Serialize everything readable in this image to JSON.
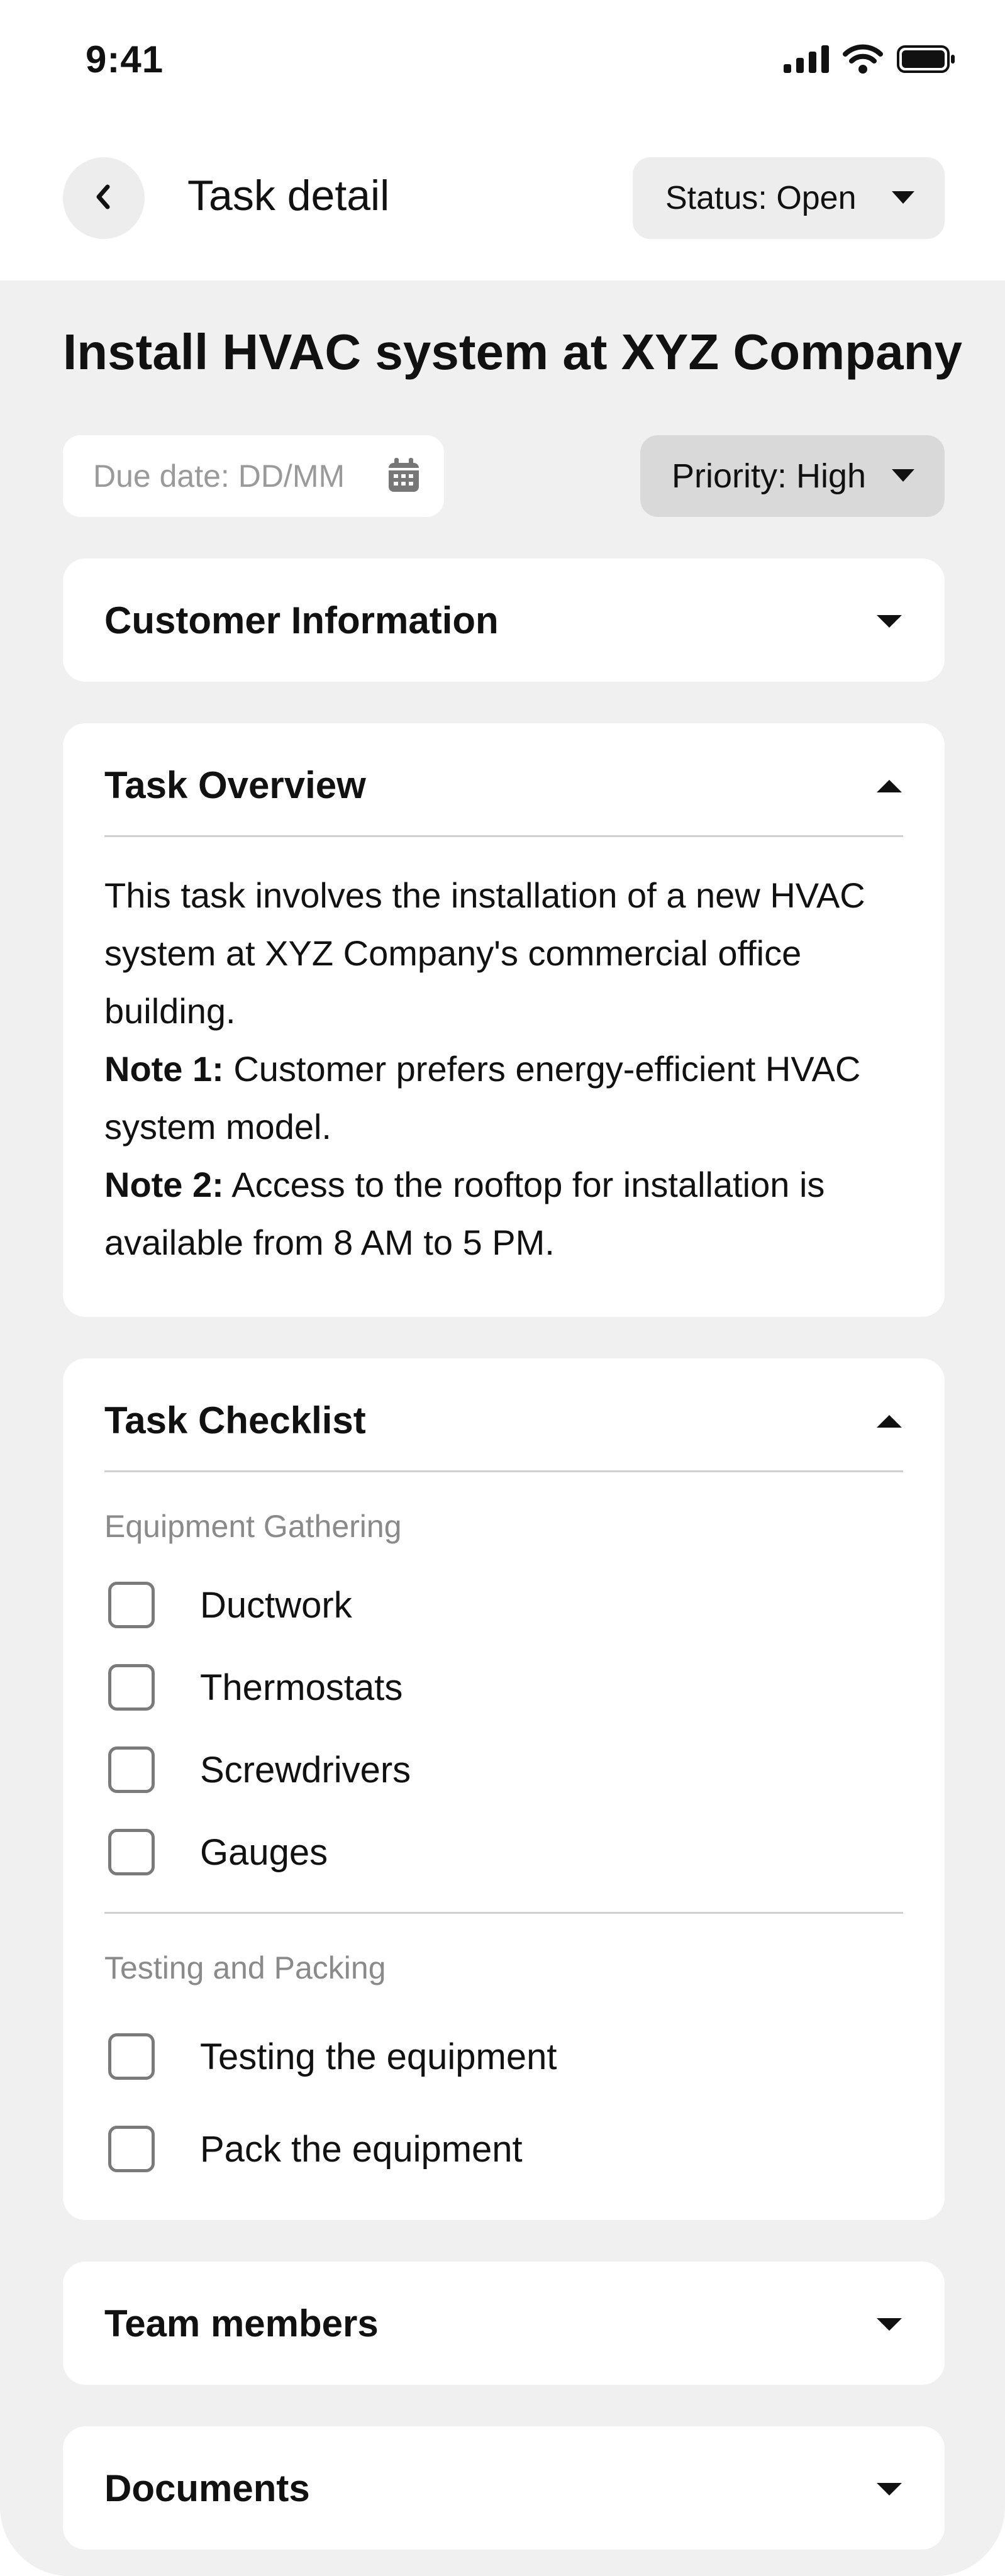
{
  "status_bar": {
    "time": "9:41"
  },
  "header": {
    "back_icon": "chevron-left-icon",
    "title": "Task detail",
    "status_select": "Status: Open"
  },
  "task": {
    "title": "Install HVAC system at XYZ Company",
    "due_date_placeholder": "Due date: DD/MM",
    "priority_select": "Priority: High"
  },
  "sections": {
    "customer_info": {
      "title": "Customer Information",
      "expanded": false
    },
    "overview": {
      "title": "Task Overview",
      "expanded": true,
      "text": "This task involves the installation of a new HVAC system at XYZ Company's commercial office building.",
      "note1_label": "Note 1:",
      "note1_text": " Customer prefers energy-efficient HVAC system model.",
      "note2_label": "Note 2:",
      "note2_text": " Access to the rooftop for installation is available from 8 AM to 5 PM."
    },
    "checklist": {
      "title": "Task Checklist",
      "expanded": true,
      "group1_label": "Equipment Gathering",
      "group1_items": [
        "Ductwork",
        "Thermostats",
        "Screwdrivers",
        "Gauges"
      ],
      "group2_label": "Testing and Packing",
      "group2_items": [
        "Testing the equipment",
        "Pack the equipment"
      ]
    },
    "team": {
      "title": "Team members",
      "expanded": false
    },
    "documents": {
      "title": "Documents",
      "expanded": false
    }
  },
  "colors": {
    "page_background": "#f0f0f0",
    "card_background": "#ffffff",
    "chip_background": "#ededed",
    "priority_background": "#d9d9d9",
    "muted_text": "#8a8a8a"
  }
}
